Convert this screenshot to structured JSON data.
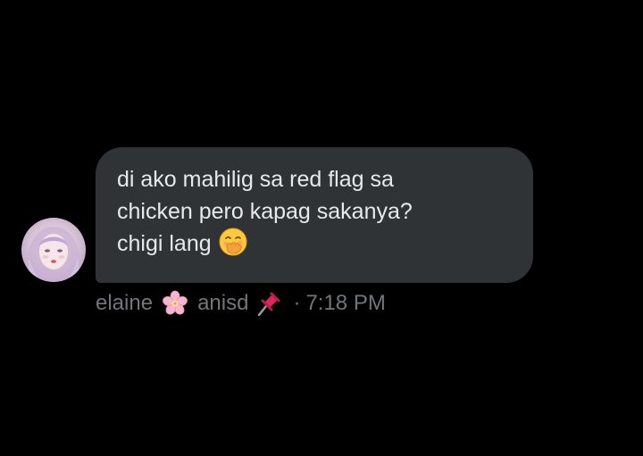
{
  "message": {
    "lines": [
      "di ako mahilig sa red flag sa",
      "chicken pero kapag sakanya?",
      "chigi lang"
    ],
    "emoji": "face-with-hand-over-mouth-icon"
  },
  "sender": {
    "avatar": "avatar",
    "name": "elaine",
    "name_icon": "cherry-blossom-icon",
    "handle": "anisd",
    "handle_icon": "pushpin-icon",
    "separator": "·",
    "time": "7:18 PM"
  },
  "colors": {
    "background": "#000000",
    "bubble": "#2f3336",
    "message_text": "#e7e9ea",
    "meta_text": "#71767b"
  }
}
